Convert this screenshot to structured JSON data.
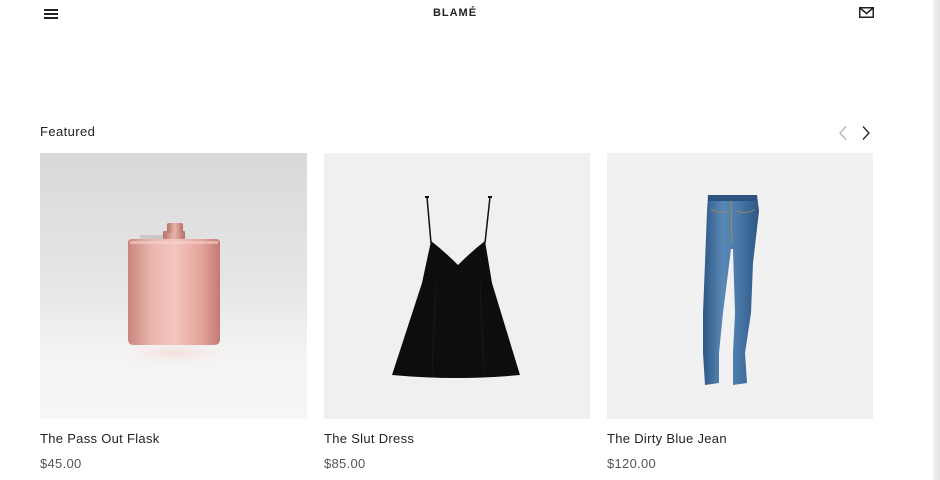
{
  "header": {
    "brand": "BLAMÉ",
    "menu_icon": "hamburger-menu-icon",
    "mail_icon": "envelope-icon"
  },
  "featured": {
    "title": "Featured",
    "prev_icon": "chevron-left-icon",
    "next_icon": "chevron-right-icon",
    "products": [
      {
        "name": "The Pass Out Flask",
        "price": "$45.00",
        "image": "rose-gold-flask"
      },
      {
        "name": "The Slut Dress",
        "price": "$85.00",
        "image": "black-slip-dress"
      },
      {
        "name": "The Dirty Blue Jean",
        "price": "$120.00",
        "image": "blue-skinny-jeans"
      }
    ]
  },
  "colors": {
    "text": "#222222",
    "price": "#555555",
    "flask": "#e8a7a0",
    "denim": "#3d6c9e"
  }
}
